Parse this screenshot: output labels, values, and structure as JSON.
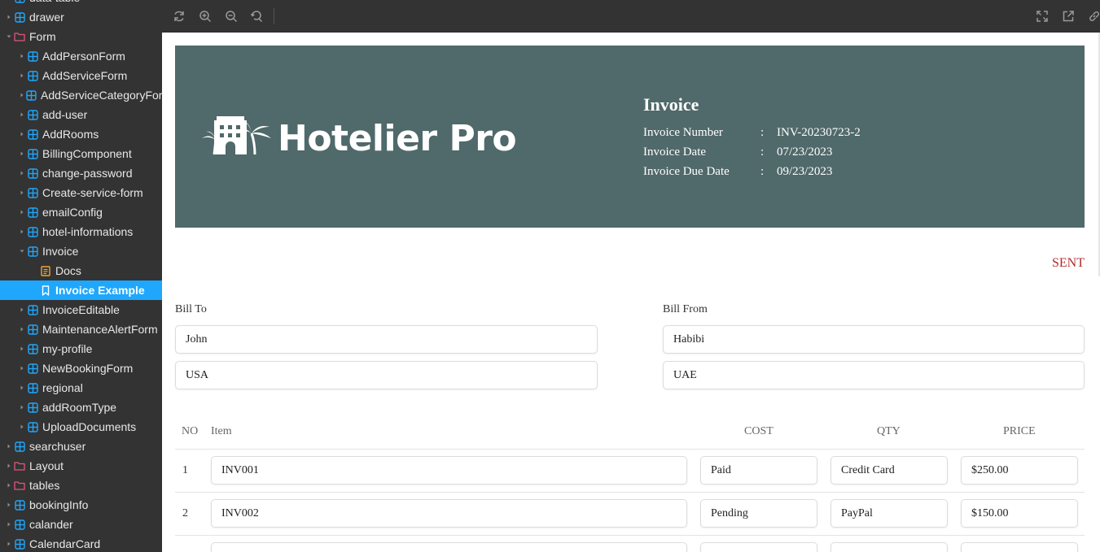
{
  "sidebar": {
    "items": [
      {
        "label": "data-table",
        "type": "component",
        "depth": 0,
        "state": "collapsed"
      },
      {
        "label": "drawer",
        "type": "component",
        "depth": 0,
        "state": "collapsed"
      },
      {
        "label": "Form",
        "type": "folder",
        "depth": 0,
        "state": "expanded"
      },
      {
        "label": "AddPersonForm",
        "type": "component",
        "depth": 1,
        "state": "collapsed"
      },
      {
        "label": "AddServiceForm",
        "type": "component",
        "depth": 1,
        "state": "collapsed"
      },
      {
        "label": "AddServiceCategoryForm",
        "type": "component",
        "depth": 1,
        "state": "collapsed"
      },
      {
        "label": "add-user",
        "type": "component",
        "depth": 1,
        "state": "collapsed"
      },
      {
        "label": "AddRooms",
        "type": "component",
        "depth": 1,
        "state": "collapsed"
      },
      {
        "label": "BillingComponent",
        "type": "component",
        "depth": 1,
        "state": "collapsed"
      },
      {
        "label": "change-password",
        "type": "component",
        "depth": 1,
        "state": "collapsed"
      },
      {
        "label": "Create-service-form",
        "type": "component",
        "depth": 1,
        "state": "collapsed"
      },
      {
        "label": "emailConfig",
        "type": "component",
        "depth": 1,
        "state": "collapsed"
      },
      {
        "label": "hotel-informations",
        "type": "component",
        "depth": 1,
        "state": "collapsed"
      },
      {
        "label": "Invoice",
        "type": "component",
        "depth": 1,
        "state": "expanded"
      },
      {
        "label": "Docs",
        "type": "doc",
        "depth": 2,
        "state": "leaf"
      },
      {
        "label": "Invoice Example",
        "type": "story",
        "depth": 2,
        "state": "selected"
      },
      {
        "label": "InvoiceEditable",
        "type": "component",
        "depth": 1,
        "state": "collapsed"
      },
      {
        "label": "MaintenanceAlertForm",
        "type": "component",
        "depth": 1,
        "state": "collapsed"
      },
      {
        "label": "my-profile",
        "type": "component",
        "depth": 1,
        "state": "collapsed"
      },
      {
        "label": "NewBookingForm",
        "type": "component",
        "depth": 1,
        "state": "collapsed"
      },
      {
        "label": "regional",
        "type": "component",
        "depth": 1,
        "state": "collapsed"
      },
      {
        "label": "addRoomType",
        "type": "component",
        "depth": 1,
        "state": "collapsed"
      },
      {
        "label": "UploadDocuments",
        "type": "component",
        "depth": 1,
        "state": "collapsed"
      },
      {
        "label": "searchuser",
        "type": "component",
        "depth": 0,
        "state": "collapsed"
      },
      {
        "label": "Layout",
        "type": "folder",
        "depth": 0,
        "state": "collapsed"
      },
      {
        "label": "tables",
        "type": "folder",
        "depth": 0,
        "state": "collapsed"
      },
      {
        "label": "bookingInfo",
        "type": "component",
        "depth": 0,
        "state": "collapsed"
      },
      {
        "label": "calander",
        "type": "component",
        "depth": 0,
        "state": "collapsed"
      },
      {
        "label": "CalendarCard",
        "type": "component",
        "depth": 0,
        "state": "collapsed"
      }
    ]
  },
  "toolbar": {
    "left_icons": [
      "reload-icon",
      "zoom-in-icon",
      "zoom-out-icon",
      "reset-zoom-icon"
    ],
    "right_icons": [
      "fullscreen-icon",
      "open-new-tab-icon",
      "copy-link-icon"
    ]
  },
  "invoice": {
    "brand": "Hotelier Pro",
    "title": "Invoice",
    "number_label": "Invoice Number",
    "number": "INV-20230723-2",
    "date_label": "Invoice Date",
    "date": "07/23/2023",
    "due_label": "Invoice Due Date",
    "due": "09/23/2023",
    "separator": ":",
    "status": "SENT",
    "bill_to": {
      "label": "Bill To",
      "name": "John",
      "country": "USA"
    },
    "bill_from": {
      "label": "Bill From",
      "name": "Habibi",
      "country": "UAE"
    },
    "table": {
      "headers": {
        "no": "NO",
        "item": "Item",
        "cost": "COST",
        "qty": "QTY",
        "price": "PRICE"
      },
      "rows": [
        {
          "no": "1",
          "item": "INV001",
          "cost": "Paid",
          "qty": "Credit Card",
          "price": "$250.00"
        },
        {
          "no": "2",
          "item": "INV002",
          "cost": "Pending",
          "qty": "PayPal",
          "price": "$150.00"
        },
        {
          "no": "",
          "item": "",
          "cost": "",
          "qty": "",
          "price": ""
        }
      ]
    }
  },
  "colors": {
    "sidebar_bg": "#333333",
    "selected": "#1ea7fd",
    "banner": "#50696a",
    "status": "#b22b2b",
    "folder": "#e2557a",
    "component": "#1ea7fd",
    "doc": "#f0a534"
  }
}
